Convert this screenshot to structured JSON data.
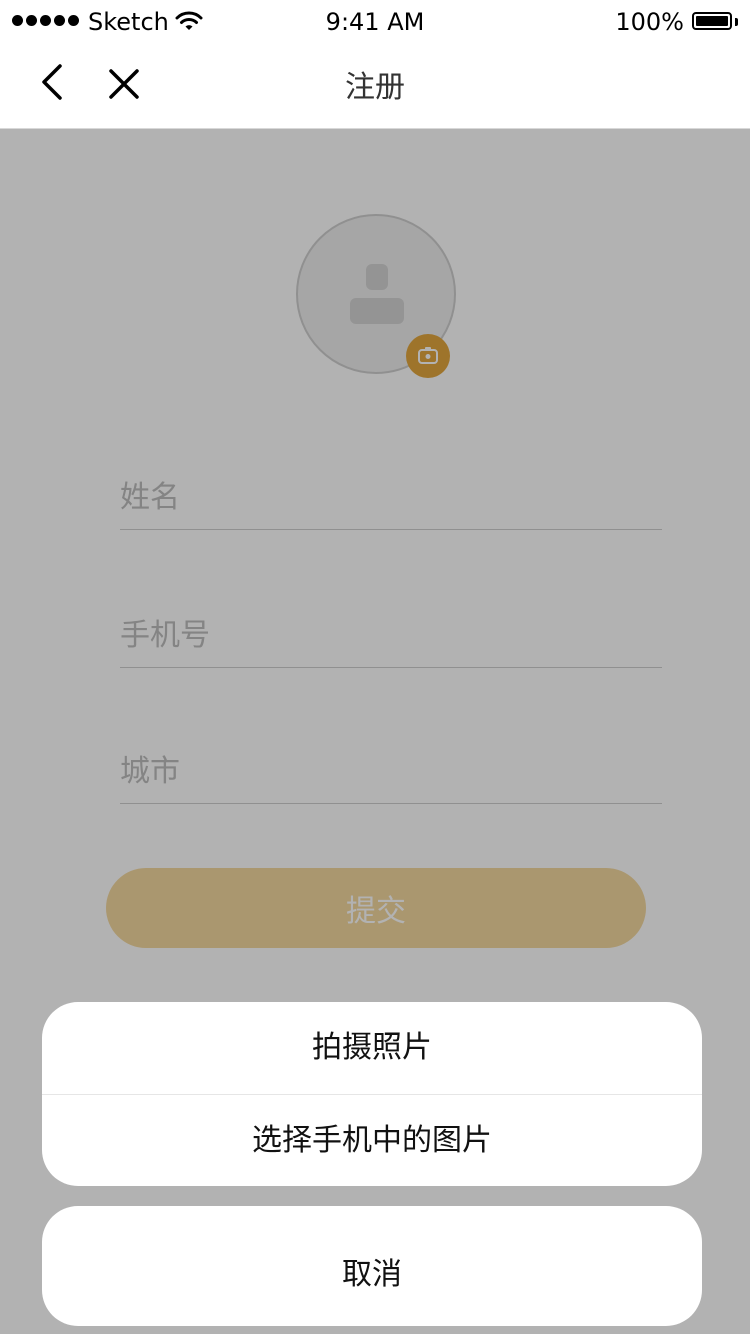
{
  "status_bar": {
    "carrier": "Sketch",
    "time": "9:41 AM",
    "battery": "100%"
  },
  "nav": {
    "title": "注册",
    "back_icon": "chevron-left-icon",
    "close_icon": "close-icon"
  },
  "form": {
    "avatar_icon": "person-icon",
    "camera_icon": "camera-icon",
    "name_placeholder": "姓名",
    "phone_placeholder": "手机号",
    "city_placeholder": "城市",
    "submit_label": "提交"
  },
  "action_sheet": {
    "options": [
      "拍摄照片",
      "选择手机中的图片"
    ],
    "cancel_label": "取消"
  },
  "colors": {
    "accent": "#e2a73e",
    "submit_bg": "#f4d8a0",
    "overlay": "rgba(0,0,0,0.30)"
  }
}
